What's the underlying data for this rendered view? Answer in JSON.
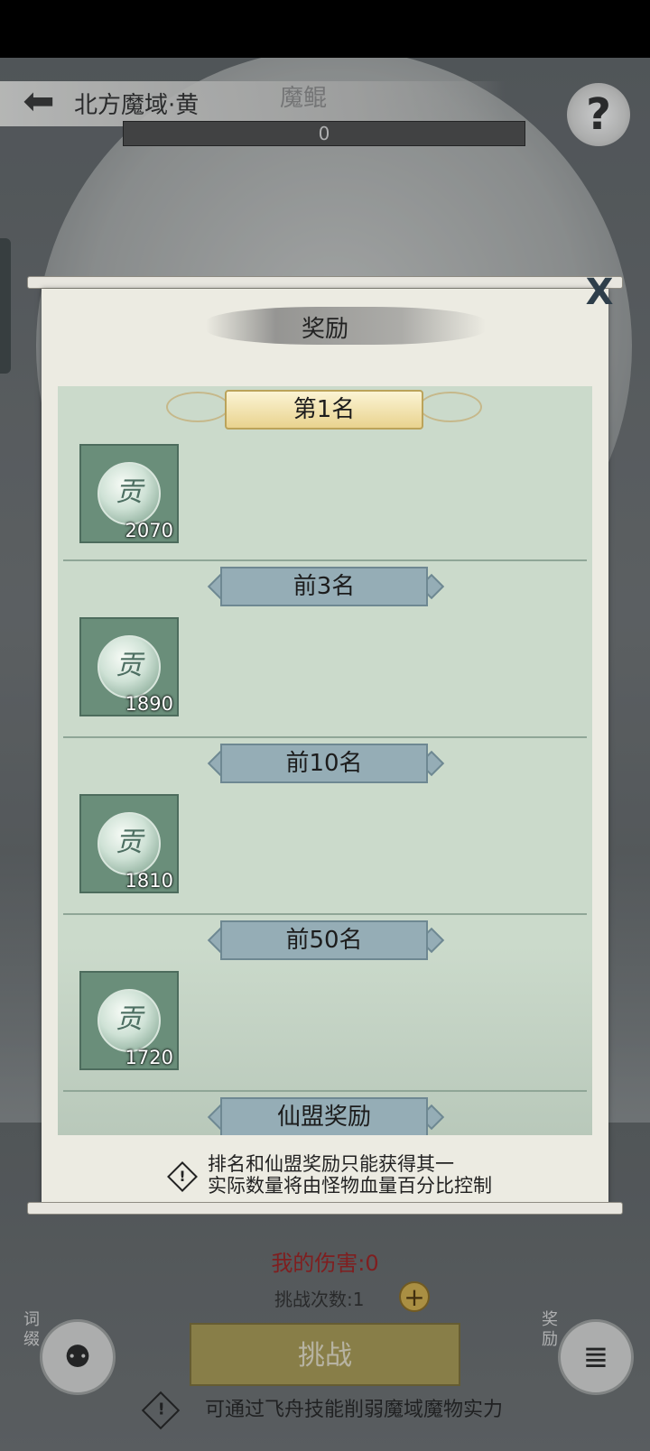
{
  "header": {
    "back_icon": "back-arrow-icon",
    "zone_title": "北方魔域·黄",
    "boss_name": "魔鲲",
    "boss_hp": "0",
    "help_label": "?"
  },
  "modal": {
    "title": "奖励",
    "close_label": "X",
    "tiers": [
      {
        "label": "第1名",
        "style": "gold",
        "item": {
          "icon": "contribution-coin-icon",
          "glyph": "贡",
          "qty": "2070"
        }
      },
      {
        "label": "前3名",
        "style": "blue",
        "item": {
          "icon": "contribution-coin-icon",
          "glyph": "贡",
          "qty": "1890"
        }
      },
      {
        "label": "前10名",
        "style": "blue",
        "item": {
          "icon": "contribution-coin-icon",
          "glyph": "贡",
          "qty": "1810"
        }
      },
      {
        "label": "前50名",
        "style": "blue",
        "item": {
          "icon": "contribution-coin-icon",
          "glyph": "贡",
          "qty": "1720"
        }
      },
      {
        "label": "仙盟奖励",
        "style": "blue"
      }
    ],
    "note_line1": "排名和仙盟奖励只能获得其一",
    "note_line2": "实际数量将由怪物血量百分比控制",
    "note_icon": "warning-icon"
  },
  "bottom": {
    "my_damage": "我的伤害:0",
    "attempts": "挑战次数:1",
    "plus_label": "+",
    "challenge_label": "挑战",
    "left_side_label": "词缀",
    "right_side_label": "奖励",
    "left_icon": "affix-beast-icon",
    "right_icon": "reward-chest-icon",
    "tip": "可通过飞舟技能削弱魔域魔物实力",
    "tip_icon": "warning-icon"
  },
  "colors": {
    "panel_bg": "#ecebe2",
    "list_bg": "#cbdacb",
    "tier_blue": "#95adb6",
    "tier_gold": "#e9d38f",
    "damage_red": "#9c1a1a",
    "challenge_btn": "#a99a50"
  }
}
